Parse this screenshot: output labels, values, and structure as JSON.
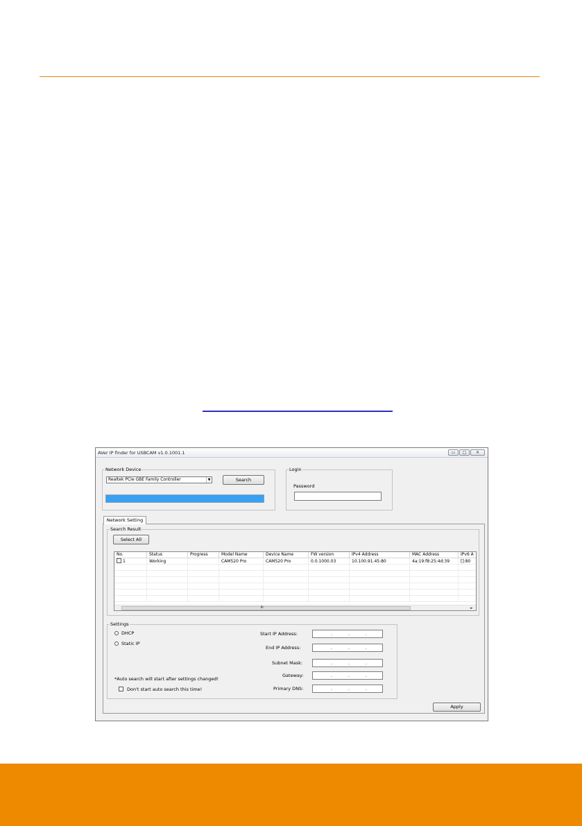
{
  "window": {
    "title": "AVer IP finder for USBCAM v1.0.1001.1",
    "controls": {
      "minimize": "▭",
      "maximize": "□",
      "close": "✕"
    }
  },
  "network_device": {
    "group_label": "Network Device",
    "selected_adapter": "Realtek PCIe GBE Family Controller",
    "search_button": "Search",
    "progress_fraction": 1.0
  },
  "login": {
    "group_label": "Login",
    "password_label": "Password",
    "password_value": ""
  },
  "tabs": [
    {
      "label": "Network Setting",
      "active": true
    }
  ],
  "search_result": {
    "group_label": "Search Result",
    "select_all_button": "Select All",
    "columns": [
      "No.",
      "Status",
      "Progress",
      "Model Name",
      "Device Name",
      "FW version",
      "IPv4 Address",
      "MAC Address",
      "IPv6 A"
    ],
    "rows": [
      {
        "no": "1",
        "status": "Working",
        "progress": "",
        "model": "CAM520 Pro",
        "device": "CAM520 Pro",
        "fw": "0.0.1000.03",
        "ipv4": "10.100.91.45:80",
        "mac": "4a:19:f8:25:4d:39",
        "ipv6": "[]:80"
      }
    ],
    "scroll_thumb_glyph": "III",
    "scroll_right_glyph": "►"
  },
  "settings": {
    "group_label": "Settings",
    "mode_options": [
      "DHCP",
      "Static IP"
    ],
    "note": "*Auto search will start after settings changed!",
    "checkbox_label": "Don't start auto search this time!",
    "fields": [
      {
        "label": "Start IP Address:"
      },
      {
        "label": "End IP Address:"
      },
      {
        "label": "Subnet Mask:"
      },
      {
        "label": "Gateway:"
      },
      {
        "label": "Primary DNS:"
      }
    ],
    "ip_dot": "."
  },
  "apply_button": "Apply",
  "colors": {
    "accent_orange": "#ee8a00",
    "rule_orange": "#e8820e",
    "link_blue": "#2e2eb8",
    "progress_blue": "#3aa0f2"
  }
}
